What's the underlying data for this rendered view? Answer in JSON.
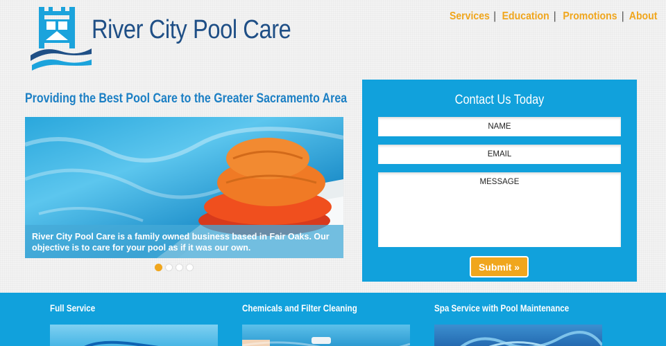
{
  "brand": {
    "name": "River City Pool Care"
  },
  "nav": {
    "items": [
      "Services",
      "Education",
      "Promotions",
      "About"
    ]
  },
  "tagline": "Providing the Best Pool Care to the Greater Sacramento Area",
  "slider": {
    "caption": "River City Pool Care is a family owned business based in Fair Oaks. Our objective is to care for your pool as if it was our own.",
    "dot_count": 4,
    "active_dot": 1
  },
  "contact": {
    "title": "Contact Us Today",
    "name_placeholder": "NAME",
    "email_placeholder": "EMAIL",
    "message_placeholder": "MESSAGE",
    "submit_label": "Submit »"
  },
  "services": [
    {
      "title": "Full Service"
    },
    {
      "title": "Chemicals and Filter Cleaning"
    },
    {
      "title": "Spa Service with Pool Maintenance"
    }
  ],
  "colors": {
    "brand_blue": "#1f4f86",
    "accent_orange": "#f0a61d",
    "panel_blue": "#11a1dc",
    "tagline_blue": "#1b7fc4"
  }
}
